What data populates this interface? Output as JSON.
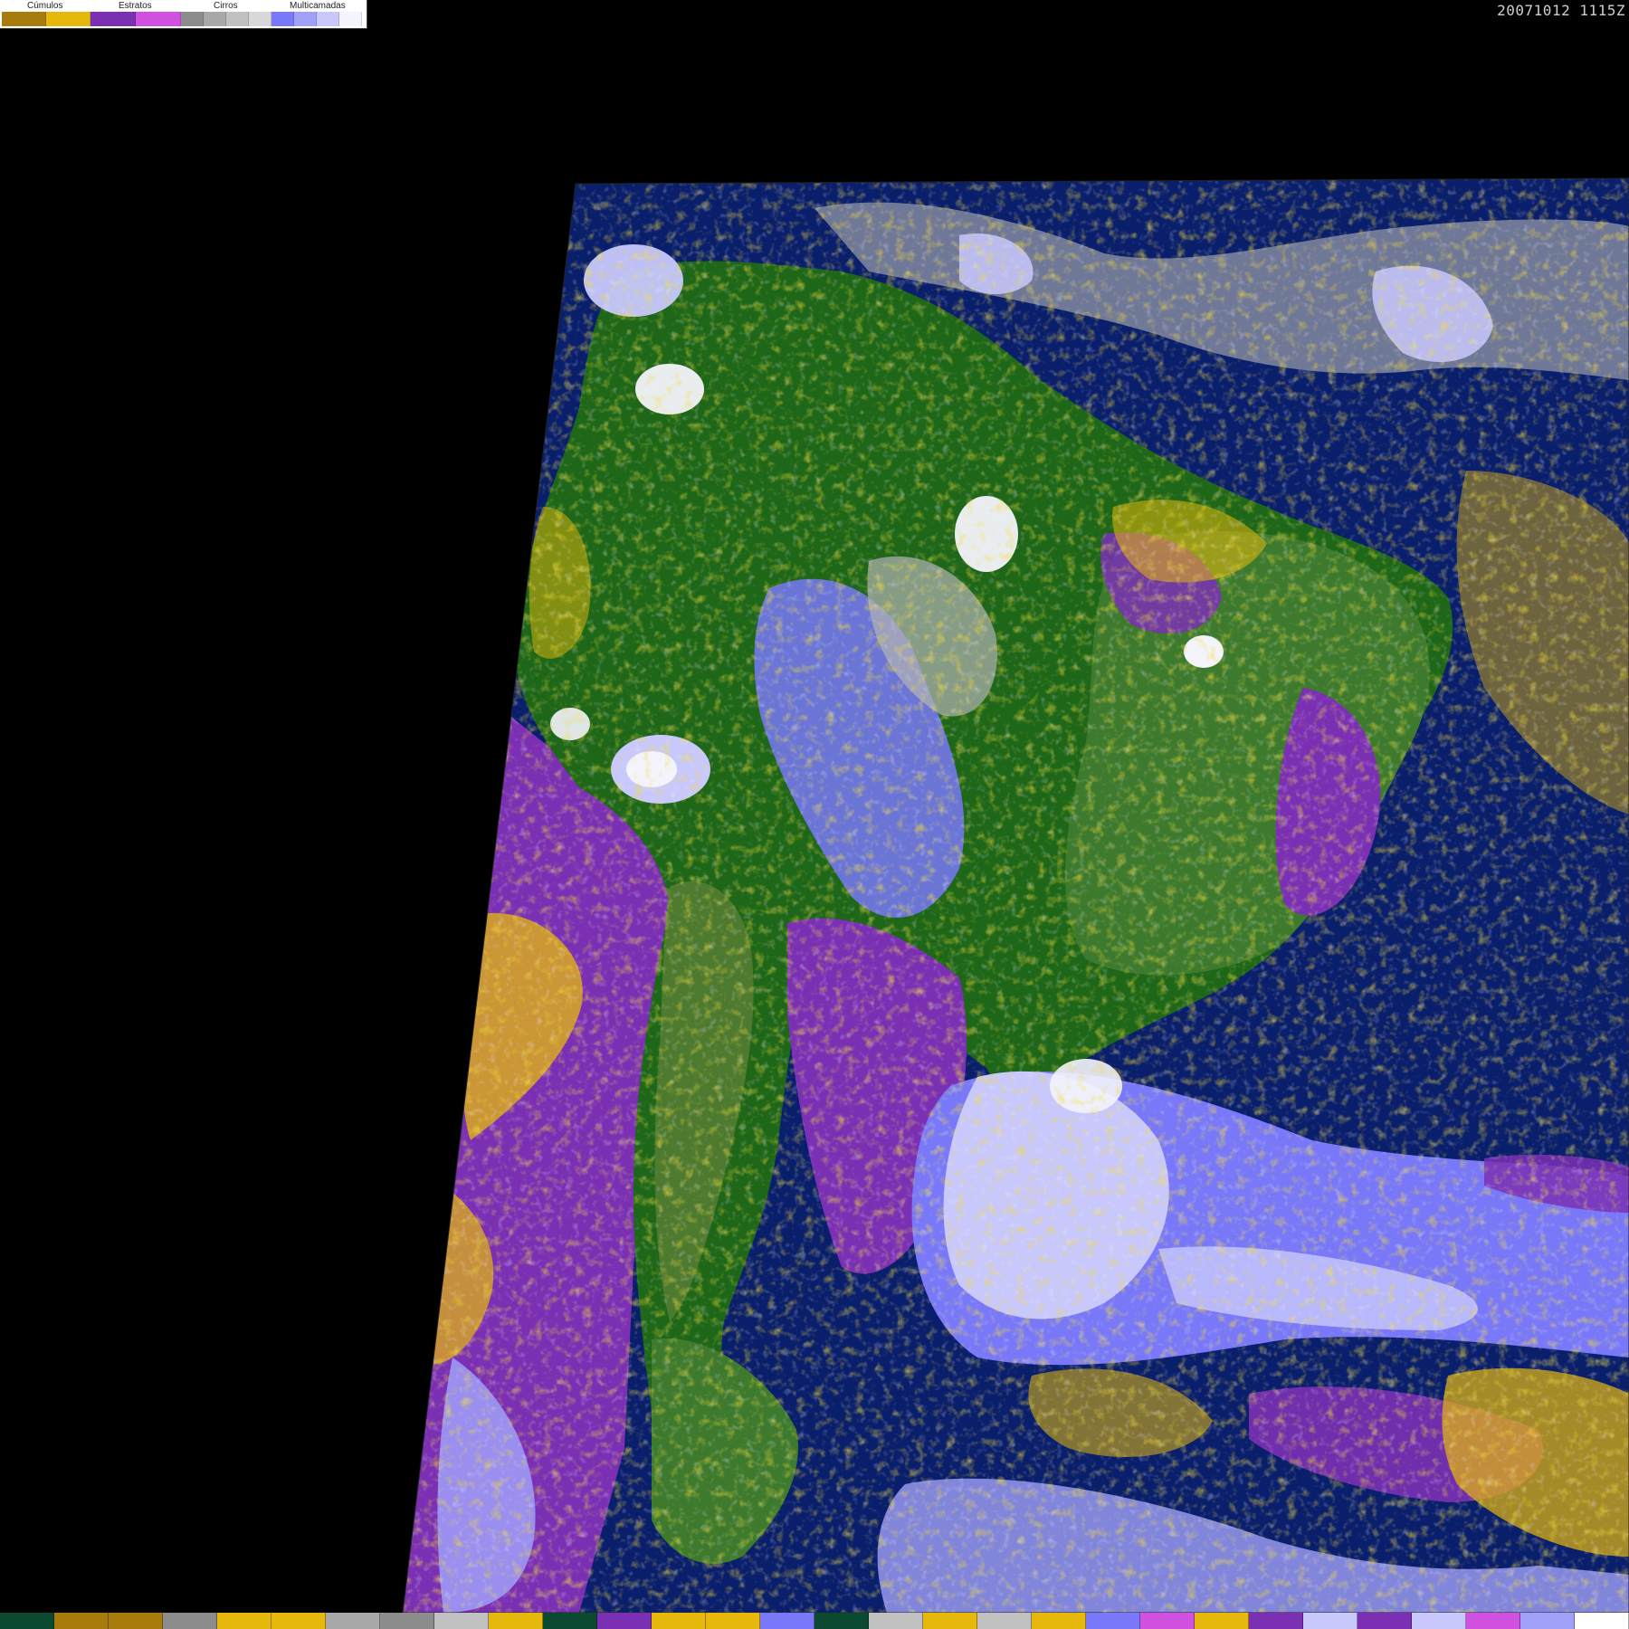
{
  "legend": {
    "groups": [
      {
        "label": "Cúmulos",
        "colors": [
          "#a87c0c",
          "#e6b80c"
        ]
      },
      {
        "label": "Estratos",
        "colors": [
          "#7b30b4",
          "#d050e0"
        ]
      },
      {
        "label": "Cirros",
        "colors": [
          "#8c8c8c",
          "#a8a8a8",
          "#c0c0c0",
          "#d8d8d8"
        ]
      },
      {
        "label": "Multicamadas",
        "colors": [
          "#7878f8",
          "#a0a0f8",
          "#c8c8fc",
          "#f4f4fc"
        ]
      }
    ]
  },
  "timestamp": "20071012 1115Z",
  "colors": {
    "background": "#000000",
    "ocean": "#0a1f6b",
    "land_forest": "#1e6618",
    "land_dry": "#3e7a2e",
    "cumulus_low": "#a87c0c",
    "cumulus_high": "#e6b80c",
    "stratus": "#7b30b4",
    "stratus_light": "#d050e0",
    "cirrus": "#b4b4b4",
    "multilayer": "#7878f8",
    "multilayer_light": "#c8c8fc"
  },
  "bottom_bar": [
    "#0b4a30",
    "#a87c0c",
    "#a87c0c",
    "#8c8c8c",
    "#e6b80c",
    "#e6b80c",
    "#a8a8a8",
    "#8c8c8c",
    "#c0c0c0",
    "#e6b80c",
    "#0b4a30",
    "#7b30b4",
    "#e6b80c",
    "#e6b80c",
    "#7878f8",
    "#0b4a30",
    "#c0c0c0",
    "#e6b80c",
    "#c0c0c0",
    "#e6b80c",
    "#7878f8",
    "#d050e0",
    "#e6b80c",
    "#7b30b4",
    "#c8c8fc",
    "#7b30b4",
    "#c8c8fc",
    "#d050e0",
    "#a0a0f8",
    "#ffffff"
  ]
}
